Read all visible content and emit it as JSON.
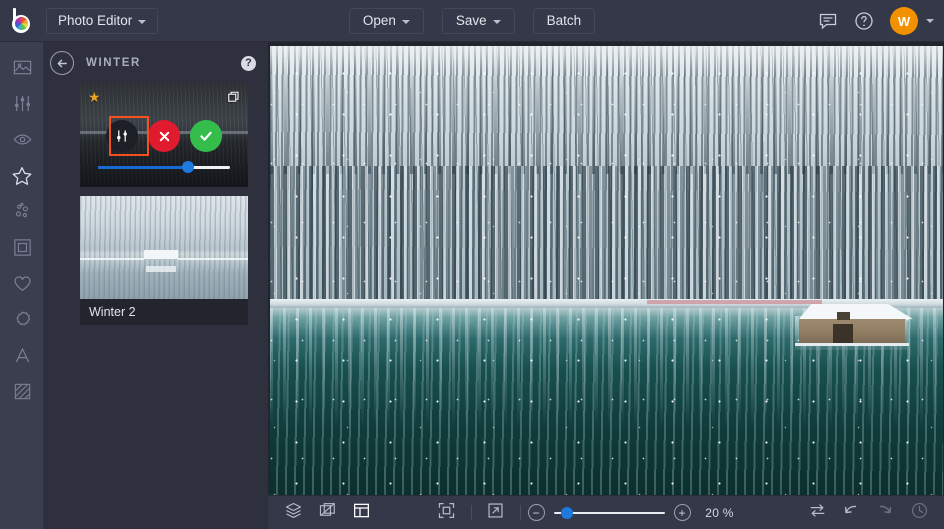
{
  "app": {
    "logo": "color-wheel-logo",
    "name": "Photo Editor"
  },
  "topbar": {
    "open_label": "Open",
    "save_label": "Save",
    "batch_label": "Batch",
    "feedback_icon": "comment-icon",
    "help_icon": "question-circle-icon",
    "avatar_initial": "W"
  },
  "rail": {
    "items": [
      {
        "name": "photo-icon",
        "label": "Photo",
        "active": false
      },
      {
        "name": "adjust-icon",
        "label": "Adjust",
        "active": false
      },
      {
        "name": "eye-icon",
        "label": "Retouch",
        "active": false
      },
      {
        "name": "star-icon",
        "label": "Effects",
        "active": true
      },
      {
        "name": "particles-icon",
        "label": "Overlays",
        "active": false
      },
      {
        "name": "frame-icon",
        "label": "Frames",
        "active": false
      },
      {
        "name": "heart-icon",
        "label": "Favorites",
        "active": false
      },
      {
        "name": "badge-icon",
        "label": "Stickers",
        "active": false
      },
      {
        "name": "text-icon",
        "label": "Text",
        "active": false
      },
      {
        "name": "texture-icon",
        "label": "Texture",
        "active": false
      }
    ]
  },
  "panel": {
    "back_icon": "back-arrow-icon",
    "title": "WINTER",
    "help_label": "?",
    "presets": [
      {
        "label": "",
        "favorite_icon": "star-filled-icon",
        "duplicate_icon": "duplicate-icon",
        "active": true,
        "actions": {
          "settings_icon": "sliders-icon",
          "cancel_icon": "close-icon",
          "apply_icon": "check-icon"
        },
        "slider_value": 68
      },
      {
        "label": "Winter 2",
        "active": false
      }
    ]
  },
  "bottombar": {
    "layers_icon": "layers-icon",
    "transform_icon": "transform-icon",
    "panels_icon": "panels-icon",
    "fit_icon": "fit-to-screen-icon",
    "expand_icon": "fullscreen-icon",
    "zoom_out_label": "−",
    "zoom_in_label": "+",
    "zoom_value": "20 %",
    "zoom_slider_value": 12,
    "compare_icon": "compare-icon",
    "undo_icon": "undo-icon",
    "redo_icon": "redo-icon",
    "history_icon": "history-clock-icon"
  },
  "colors": {
    "chrome": "#343848",
    "rail": "#3a3e4e",
    "panel": "#2e313d",
    "canvas": "#22242e",
    "accent_blue": "#1f7ae0",
    "highlight_orange": "#f4511e",
    "apply_green": "#34bd4b",
    "cancel_red": "#e01b2e",
    "avatar_orange": "#f29100",
    "favorite_gold": "#e8a227"
  }
}
